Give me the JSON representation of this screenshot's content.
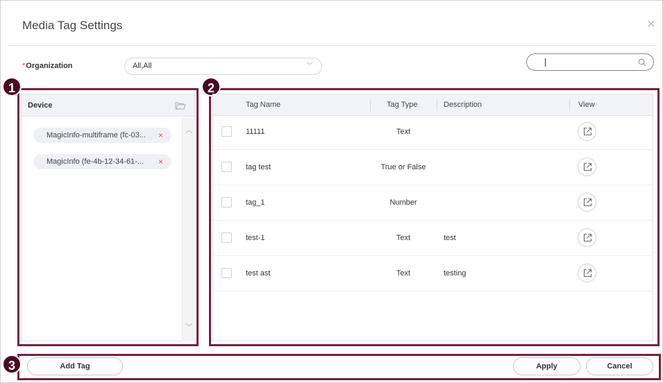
{
  "dialog": {
    "title": "Media Tag Settings",
    "close_icon": "close-icon"
  },
  "organization": {
    "required_mark": "*",
    "label": "Organization",
    "value": "All,All"
  },
  "search": {
    "value": "",
    "icon": "search-icon"
  },
  "callouts": [
    "1",
    "2",
    "3"
  ],
  "device_panel": {
    "header": "Device",
    "header_icon": "folder-open-icon",
    "devices": [
      {
        "label": "MagicInfo-multiframe (fc-03...",
        "remove": "×"
      },
      {
        "label": "MagicInfo (fe-4b-12-34-61-...",
        "remove": "×"
      }
    ]
  },
  "tag_table": {
    "columns": [
      "Tag Name",
      "Tag Type",
      "Description",
      "View"
    ],
    "rows": [
      {
        "name": "11111",
        "type": "Text",
        "description": ""
      },
      {
        "name": "tag test",
        "type": "True or False",
        "description": ""
      },
      {
        "name": "tag_1",
        "type": "Number",
        "description": ""
      },
      {
        "name": "test-1",
        "type": "Text",
        "description": "test"
      },
      {
        "name": "test ast",
        "type": "Text",
        "description": "testing"
      }
    ]
  },
  "footer": {
    "add_tag": "Add Tag",
    "apply": "Apply",
    "cancel": "Cancel"
  },
  "colors": {
    "callout_border": "#7a1f3d",
    "badge_bg": "#4a0a22",
    "remove_x": "#e8554e"
  }
}
